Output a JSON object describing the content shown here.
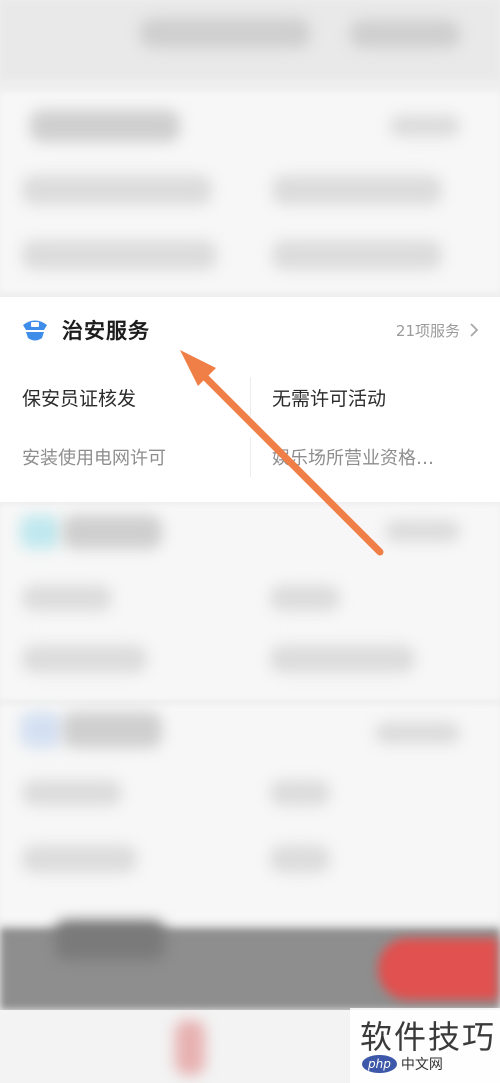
{
  "security_card": {
    "title": "治安服务",
    "count_label": "21项服务",
    "services": [
      "保安员证核发",
      "无需许可活动",
      "安装使用电网许可",
      "娱乐场所营业资格…"
    ]
  },
  "watermark": {
    "main_text": "软件技巧",
    "badge_text": "php",
    "site_text": "中文网"
  },
  "colors": {
    "accent_blue": "#3f8de8",
    "arrow_orange": "#ef7e47",
    "card_bg": "#ffffff"
  }
}
